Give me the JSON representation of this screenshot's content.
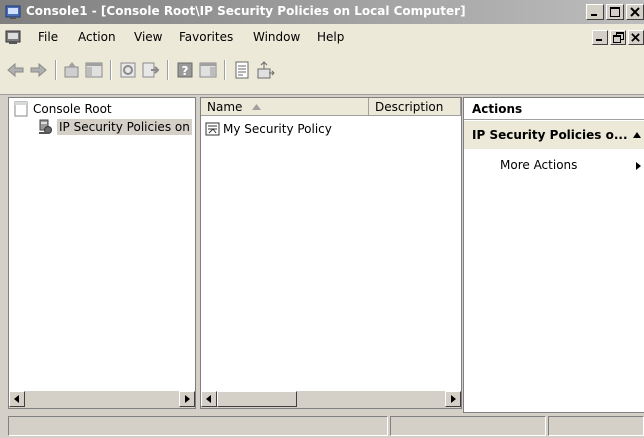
{
  "window": {
    "title": "Console1 - [Console Root\\IP Security Policies on Local Computer]",
    "controls": [
      "minimize",
      "maximize",
      "close"
    ]
  },
  "menubar": {
    "items": [
      "File",
      "Action",
      "View",
      "Favorites",
      "Window",
      "Help"
    ]
  },
  "toolbar": {
    "buttons": [
      "back-icon",
      "forward-icon",
      "up-icon",
      "show-hide-tree-icon",
      "refresh-icon",
      "export-list-icon",
      "help-icon",
      "show-hide-action-pane-icon",
      "properties-icon",
      "assign-icon"
    ]
  },
  "tree": {
    "items": [
      {
        "label": "Console Root",
        "icon": "folder-icon"
      },
      {
        "label": "IP Security Policies on",
        "icon": "ip-security-icon",
        "selected": true
      }
    ]
  },
  "list": {
    "columns": [
      "Name",
      "Description"
    ],
    "rows": [
      {
        "name": "My Security Policy",
        "description": "",
        "icon": "policy-icon"
      }
    ]
  },
  "actions": {
    "header": "Actions",
    "group": "IP Security Policies o...",
    "items": [
      "More Actions"
    ]
  },
  "colors": {
    "title_gradient_left": "#7f7f7f",
    "title_gradient_right": "#bdbdbd",
    "chrome": "#ece9d8",
    "selection": "#d4d0c8"
  }
}
